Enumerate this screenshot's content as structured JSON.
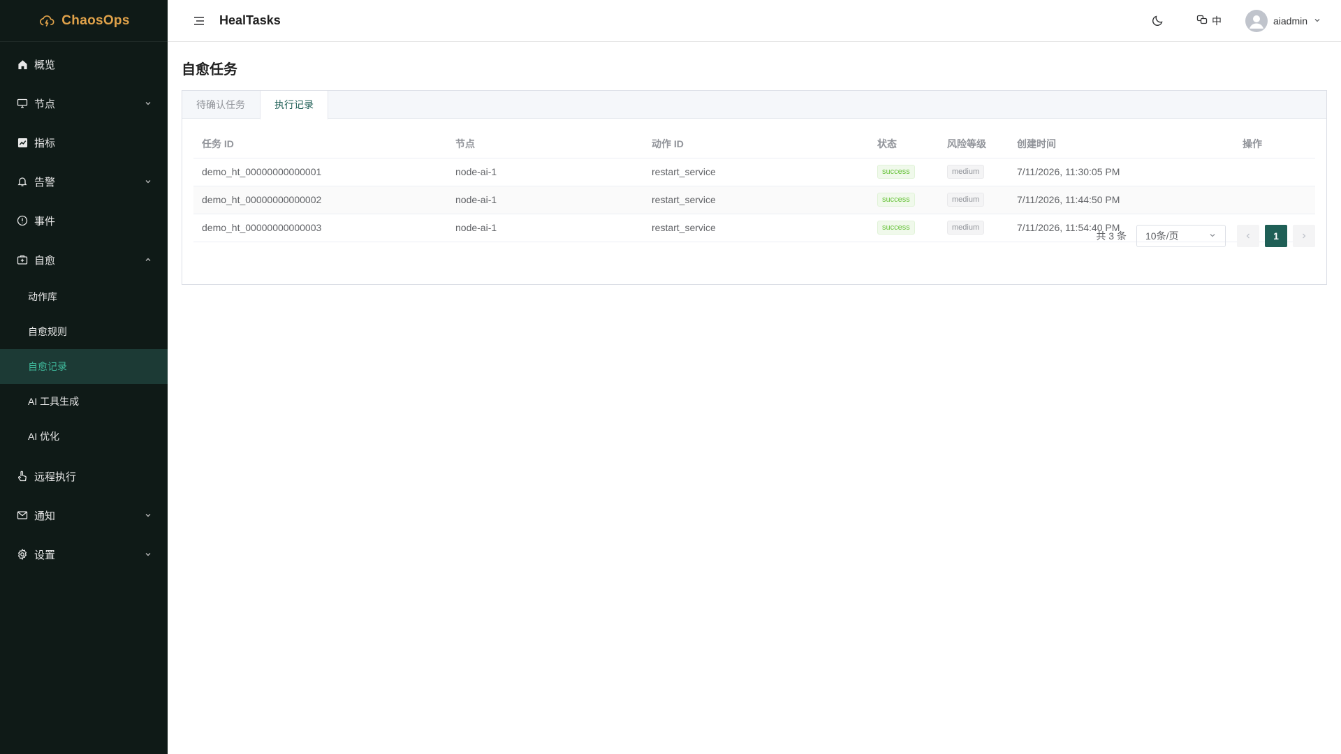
{
  "brand": {
    "name": "ChaosOps"
  },
  "header": {
    "app_title": "HealTasks",
    "lang_label": "中",
    "username": "aiadmin"
  },
  "sidebar": {
    "items": [
      {
        "label": "概览",
        "icon": "home-icon"
      },
      {
        "label": "节点",
        "icon": "monitor-icon"
      },
      {
        "label": "指标",
        "icon": "chart-icon"
      },
      {
        "label": "告警",
        "icon": "bell-icon"
      },
      {
        "label": "事件",
        "icon": "alert-circle-icon"
      },
      {
        "label": "自愈",
        "icon": "medkit-icon"
      },
      {
        "label": "远程执行",
        "icon": "hand-pointer-icon"
      },
      {
        "label": "通知",
        "icon": "mail-icon"
      },
      {
        "label": "设置",
        "icon": "gear-icon"
      }
    ],
    "sub_items": [
      {
        "label": "动作库"
      },
      {
        "label": "自愈规则"
      },
      {
        "label": "自愈记录"
      },
      {
        "label": "AI 工具生成"
      },
      {
        "label": "AI 优化"
      }
    ]
  },
  "page": {
    "title": "自愈任务"
  },
  "tabs": [
    {
      "label": "待确认任务"
    },
    {
      "label": "执行记录"
    }
  ],
  "table": {
    "columns": [
      "任务 ID",
      "节点",
      "动作 ID",
      "状态",
      "风险等级",
      "创建时间",
      "操作"
    ],
    "rows": [
      {
        "task_id": "demo_ht_00000000000001",
        "node": "node-ai-1",
        "action_id": "restart_service",
        "status": "success",
        "risk": "medium",
        "created": "7/11/2026, 11:30:05 PM"
      },
      {
        "task_id": "demo_ht_00000000000002",
        "node": "node-ai-1",
        "action_id": "restart_service",
        "status": "success",
        "risk": "medium",
        "created": "7/11/2026, 11:44:50 PM"
      },
      {
        "task_id": "demo_ht_00000000000003",
        "node": "node-ai-1",
        "action_id": "restart_service",
        "status": "success",
        "risk": "medium",
        "created": "7/11/2026, 11:54:40 PM"
      }
    ]
  },
  "pagination": {
    "total_label": "共 3 条",
    "page_size": "10条/页",
    "current_page": "1"
  },
  "colors": {
    "sidebar_bg": "#0f1a17",
    "brand": "#e0a24a",
    "accent": "#1f5f56",
    "active_sub_text": "#3fb89b",
    "success": "#67c23a"
  }
}
